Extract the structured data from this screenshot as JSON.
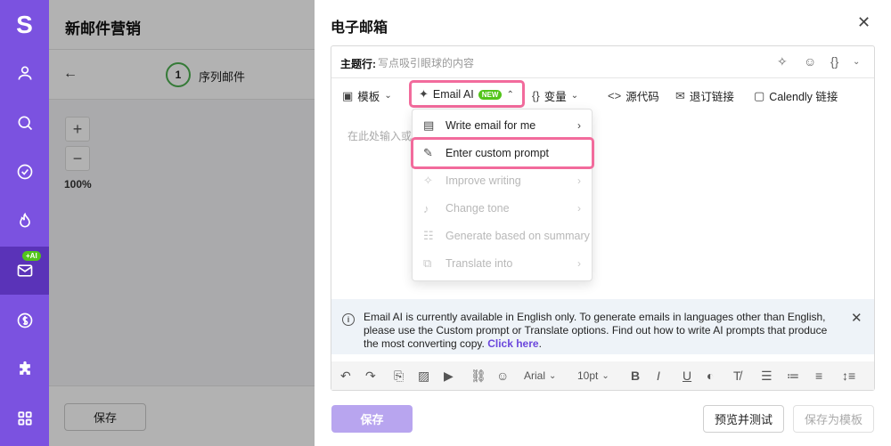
{
  "nav": {
    "logo": "S",
    "ai_badge": "+AI",
    "items": [
      {
        "icon": "user-icon"
      },
      {
        "icon": "search-icon"
      },
      {
        "icon": "check-circle-icon"
      },
      {
        "icon": "flame-icon"
      },
      {
        "icon": "mail-icon",
        "active": true
      },
      {
        "icon": "dollar-icon"
      },
      {
        "icon": "puzzle-icon"
      },
      {
        "icon": "grid-icon"
      }
    ]
  },
  "background": {
    "title": "新邮件营销",
    "step_number": "1",
    "step_label": "序列邮件",
    "zoom_in": "+",
    "zoom_out": "−",
    "zoom_level": "100%",
    "save_button": "保存"
  },
  "panel": {
    "title": "电子邮箱",
    "subject_label": "主题行:",
    "subject_placeholder": "写点吸引眼球的内容",
    "toolbar": {
      "template": "模板",
      "email_ai": "Email AI",
      "new_badge": "NEW",
      "variables": "变量",
      "source_code": "源代码",
      "unsubscribe": "退订链接",
      "calendly": "Calendly 链接"
    },
    "body_placeholder": "在此处输入或",
    "info": {
      "text": "Email AI is currently available in English only. To generate emails in languages other than English, please use the Custom prompt or Translate options. Find out how to write AI prompts that produce the most converting copy.",
      "link": "Click here",
      "suffix": "."
    },
    "format": {
      "font": "Arial",
      "size": "10pt"
    },
    "dropdown": [
      {
        "label": "Write email for me",
        "icon": "document-icon",
        "arrow": true,
        "disabled": false
      },
      {
        "label": "Enter custom prompt",
        "icon": "pencil-icon",
        "arrow": false,
        "disabled": false
      },
      {
        "label": "Improve writing",
        "icon": "sparkle-icon",
        "arrow": true,
        "disabled": true
      },
      {
        "label": "Change tone",
        "icon": "microphone-icon",
        "arrow": true,
        "disabled": true
      },
      {
        "label": "Generate based on summary",
        "icon": "summary-icon",
        "arrow": false,
        "disabled": true
      },
      {
        "label": "Translate into",
        "icon": "translate-icon",
        "arrow": true,
        "disabled": true
      }
    ],
    "footer": {
      "save": "保存",
      "preview_test": "预览并测试",
      "save_template": "保存为模板"
    }
  },
  "colors": {
    "nav_bg": "#7b52e0",
    "nav_active": "#5a33b8",
    "highlight": "#f26b9c",
    "badge_green": "#52c41a",
    "primary_disabled": "#b8a5ef",
    "link": "#6b47dc"
  }
}
